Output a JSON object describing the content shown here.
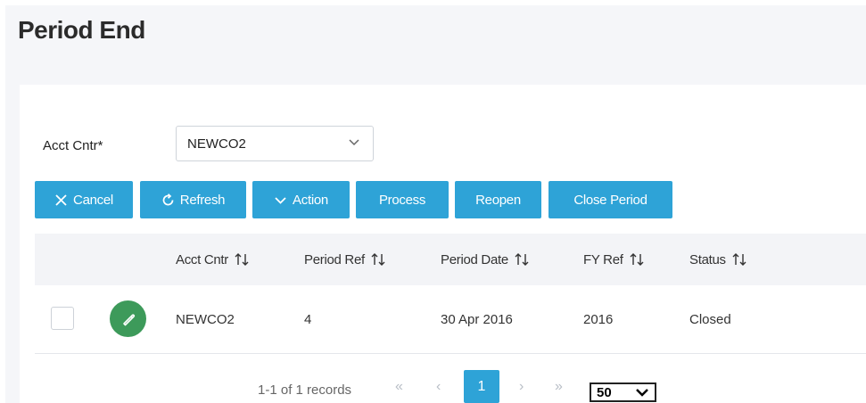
{
  "page": {
    "title": "Period End"
  },
  "filter": {
    "label": "Acct Cntr*",
    "value": "NEWCO2"
  },
  "toolbar": {
    "cancel": "Cancel",
    "refresh": "Refresh",
    "action": "Action",
    "process": "Process",
    "reopen": "Reopen",
    "close_period": "Close Period"
  },
  "table": {
    "columns": [
      "Acct Cntr",
      "Period Ref",
      "Period Date",
      "FY Ref",
      "Status"
    ],
    "rows": [
      {
        "acct_cntr": "NEWCO2",
        "period_ref": "4",
        "period_date": "30 Apr 2016",
        "fy_ref": "2016",
        "status": "Closed"
      }
    ]
  },
  "pager": {
    "records": "1-1 of 1 records",
    "first": "«",
    "prev": "‹",
    "current": "1",
    "next": "›",
    "last": "»",
    "page_size": "50"
  },
  "colors": {
    "primary": "#2ea3d7",
    "edit": "#3d9a5a"
  }
}
